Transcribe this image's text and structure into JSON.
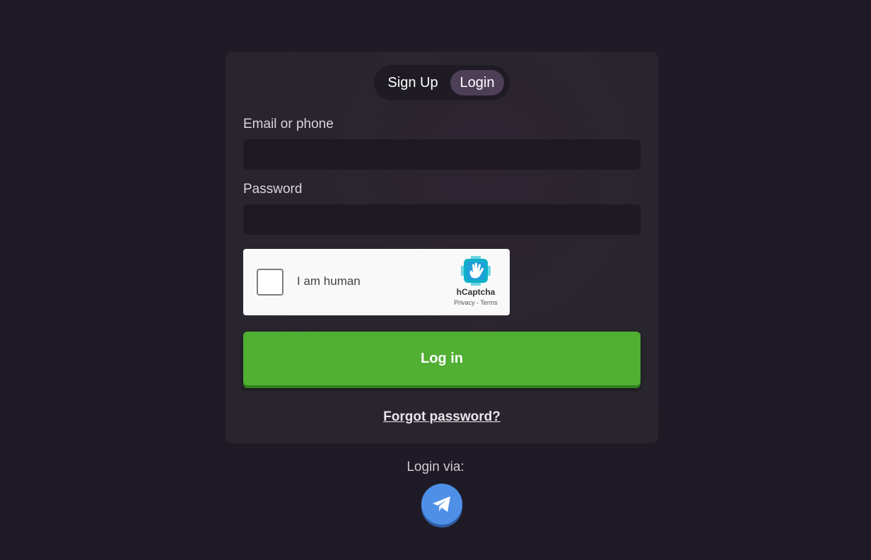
{
  "auth_tabs": {
    "signup_label": "Sign Up",
    "login_label": "Login",
    "active": "Login"
  },
  "form": {
    "email_label": "Email or phone",
    "email_value": "",
    "email_placeholder": "",
    "password_label": "Password",
    "password_value": "",
    "password_placeholder": ""
  },
  "captcha": {
    "checkbox_label": "I am human",
    "brand": "hCaptcha",
    "privacy_link": "Privacy",
    "separator": " - ",
    "terms_link": "Terms",
    "checked": false
  },
  "actions": {
    "login_button": "Log in",
    "forgot_password": "Forgot password?"
  },
  "social": {
    "login_via_label": "Login via:",
    "providers": [
      {
        "icon": "telegram-icon"
      }
    ]
  },
  "colors": {
    "page_background": "#1f1b26",
    "card_background": "#29252e",
    "active_tab": "#4e3f58",
    "primary_button": "#51af33",
    "telegram_button": "#4e8fe8"
  }
}
